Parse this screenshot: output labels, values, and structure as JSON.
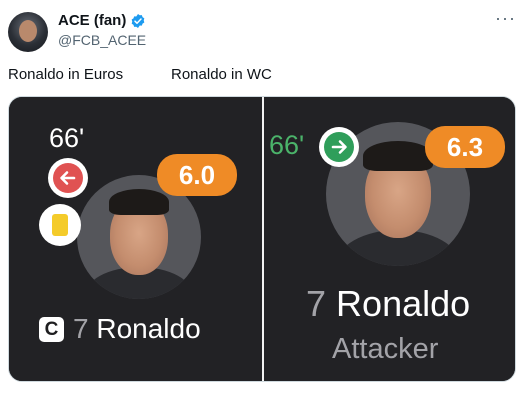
{
  "tweet": {
    "display_name": "ACE (fan)",
    "handle": "@FCB_ACEE",
    "verified_icon": "verified-badge-icon",
    "more_icon": "more-options-icon",
    "caption_left": "Ronaldo in Euros",
    "caption_right": "Ronaldo in WC"
  },
  "media": {
    "left_card": {
      "minute": "66'",
      "sub_icon": "arrow-left-icon",
      "rating": "6.0",
      "rating_color": "#ef8b26",
      "card_icon": "yellow-card-icon",
      "captain_badge": "C",
      "number": "7",
      "player": "Ronaldo"
    },
    "right_card": {
      "minute": "66'",
      "sub_icon": "arrow-right-icon",
      "rating": "6.3",
      "rating_color": "#ef8b26",
      "number": "7",
      "player": "Ronaldo",
      "position": "Attacker"
    }
  },
  "colors": {
    "sub_off": "#e05252",
    "sub_on": "#2f9e5a",
    "verified": "#1d9bf0"
  }
}
